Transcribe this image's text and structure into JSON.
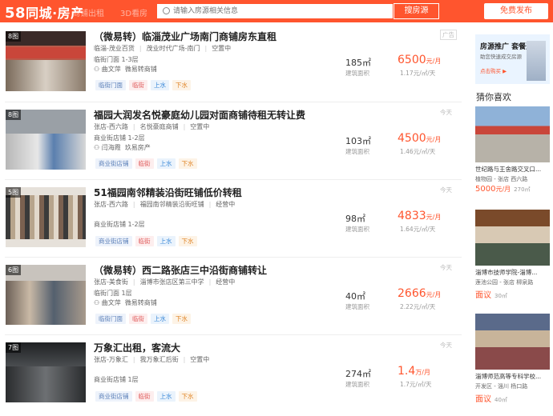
{
  "header": {
    "logo_num": "58",
    "logo_text": "同城·房产",
    "nav_faded": [
      "商铺出租",
      "3D看房"
    ],
    "search_placeholder": "请输入房源相关信息",
    "search_button": "搜房源",
    "publish_button": "免费发布"
  },
  "listings": [
    {
      "photo_count": "8图",
      "title": "（微易转）临淄茂业广场南门商铺房东直租",
      "meta": [
        "临淄-茂业百货",
        "茂业时代广场-南门",
        "空置中"
      ],
      "floor": "临街门面 1-3层",
      "agent": "曲文萍",
      "agent_org": "微易转商铺",
      "tags": [
        "临街门面",
        "临街",
        "上水",
        "下水"
      ],
      "area": "185㎡",
      "area_label": "建筑面积",
      "price": "6500",
      "price_unit": "元/月",
      "price_sub": "1.17元/㎡/天",
      "date": "广告"
    },
    {
      "photo_count": "8图",
      "title": "福园大润发名悦豪庭幼儿园对面商铺待租无转让费",
      "meta": [
        "张店-西六路",
        "名悦豪庭商铺",
        "空置中"
      ],
      "floor": "商业街店铺 1-2层",
      "agent": "闫海霞",
      "agent_org": "玖易房产",
      "tags": [
        "商业街店铺",
        "临街",
        "上水",
        "下水"
      ],
      "area": "103㎡",
      "area_label": "建筑面积",
      "price": "4500",
      "price_unit": "元/月",
      "price_sub": "1.46元/㎡/天",
      "date": "今天"
    },
    {
      "photo_count": "5图",
      "title": "51福园南邻精装沿街旺铺低价转租",
      "meta": [
        "张店-西六路",
        "福园南邻精装沿街旺铺",
        "经营中"
      ],
      "floor": "商业街店铺 1-2层",
      "agent": "",
      "agent_org": "",
      "tags": [
        "商业街店铺",
        "临街",
        "上水",
        "下水"
      ],
      "area": "98㎡",
      "area_label": "建筑面积",
      "price": "4833",
      "price_unit": "元/月",
      "price_sub": "1.64元/㎡/天",
      "date": "今天"
    },
    {
      "photo_count": "6图",
      "title": "（微易转）西二路张店三中沿街商铺转让",
      "meta": [
        "张店-美食街",
        "淄博市张店区第三中学",
        "经营中"
      ],
      "floor": "临街门面 1层",
      "agent": "曲文萍",
      "agent_org": "微易转商铺",
      "tags": [
        "临街门面",
        "临街",
        "上水",
        "下水"
      ],
      "area": "40㎡",
      "area_label": "建筑面积",
      "price": "2666",
      "price_unit": "元/月",
      "price_sub": "2.22元/㎡/天",
      "date": "今天"
    },
    {
      "photo_count": "7图",
      "title": "万象汇出租，客流大",
      "meta": [
        "张店-万象汇",
        "我万象汇后街",
        "空置中"
      ],
      "floor": "商业街店铺 1层",
      "agent": "",
      "agent_org": "",
      "tags": [
        "商业街店铺",
        "临街",
        "上水",
        "下水"
      ],
      "area": "274㎡",
      "area_label": "建筑面积",
      "price": "1.4",
      "price_unit": "万/月",
      "price_sub": "1.7元/㎡/天",
      "date": "今天"
    }
  ],
  "sidebar": {
    "ad_title": "房源推广 套餐选购",
    "ad_sub": "助您快速成交房源",
    "ad_link": "点击购买 ▶",
    "guess_title": "猜你喜欢",
    "recs": [
      {
        "title": "世纪路与王舍路交叉口...",
        "loc": "植物园 - 张店 西六路",
        "price": "5000",
        "unit": "元/月",
        "area": "270㎡"
      },
      {
        "title": "淄博市技师学院-淄博...",
        "loc": "莲池公园 - 张店 柳泉路",
        "price": "面议",
        "unit": "",
        "area": "30㎡"
      },
      {
        "title": "淄博师范高等专科学校...",
        "loc": "开发区 - 淄川 杨口路",
        "price": "面议",
        "unit": "",
        "area": "40㎡"
      }
    ]
  },
  "colors": {
    "brand": "#ff552e",
    "price": "#ff552e"
  }
}
